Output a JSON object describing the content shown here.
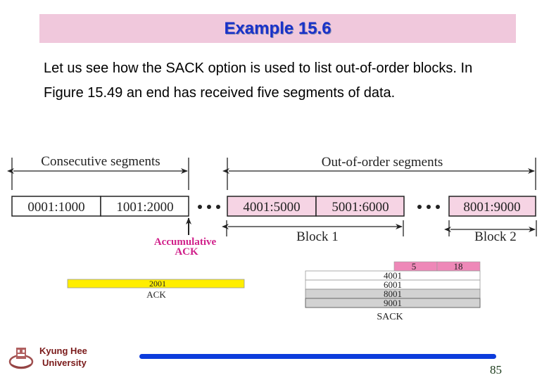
{
  "slide": {
    "title": "Example 15.6",
    "body": "Let us see how the SACK option is used to list out-of-order blocks. In Figure 15.49 an end has received five segments of data.",
    "page_number": "85"
  },
  "figure": {
    "consecutive_label": "Consecutive segments",
    "out_of_order_label": "Out-of-order segments",
    "segments": {
      "s1": "0001:1000",
      "s2": "1001:2000",
      "s3": "4001:5000",
      "s4": "5001:6000",
      "s5": "8001:9000"
    },
    "block1_label": "Block 1",
    "block2_label": "Block 2",
    "accumulative_ack_line1": "Accumulative",
    "accumulative_ack_line2": "ACK",
    "ack_value": "2001",
    "ack_label": "ACK",
    "sack_kind": "5",
    "sack_length": "18",
    "sack_rows": [
      "4001",
      "6001",
      "8001",
      "9001"
    ],
    "sack_label": "SACK",
    "colors": {
      "out_of_order_fill": "#f6d4e4",
      "ack_fill": "#ffee00",
      "sack_header_fill": "#ee88b8",
      "sack_gray": "#d2d2d2",
      "accumulative_text": "#d0208a"
    }
  },
  "footer": {
    "university_line1": "Kyung Hee",
    "university_line2": "University"
  }
}
